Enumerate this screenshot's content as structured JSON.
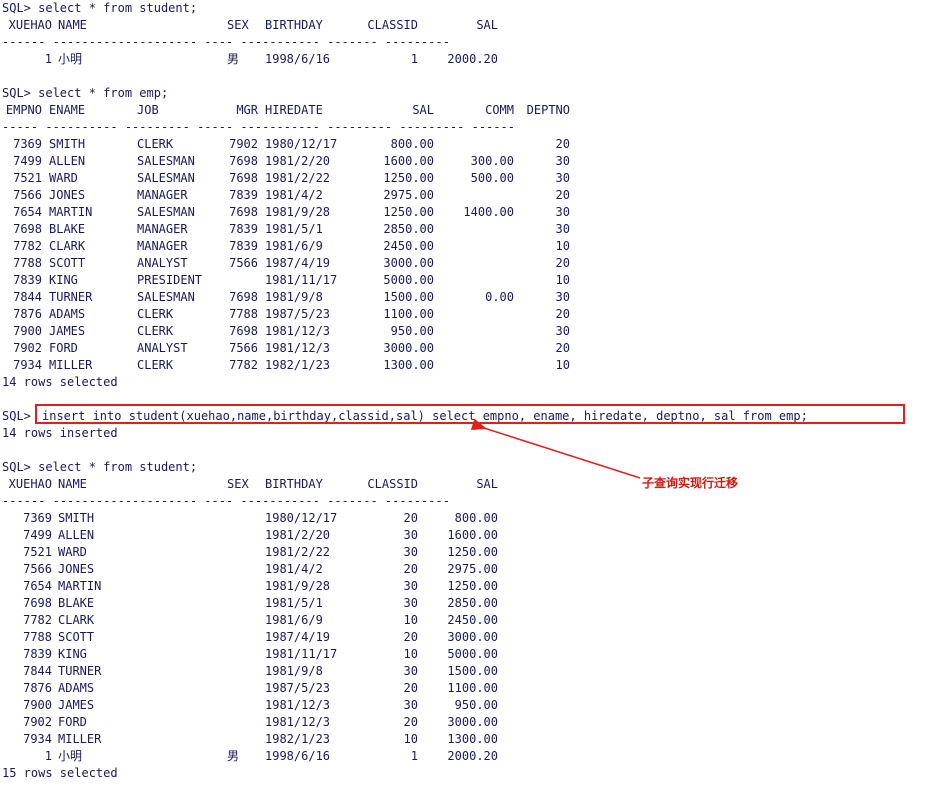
{
  "q1": {
    "prompt": "SQL> select * from student;",
    "headers": [
      "XUEHAO",
      "NAME",
      "SEX",
      "BIRTHDAY",
      "CLASSID",
      "SAL"
    ],
    "rule": "------ -------------------- ---- ----------- ------- ---------",
    "rows": [
      [
        "1",
        "小明",
        "男",
        "1998/6/16",
        "1",
        "2000.20"
      ]
    ]
  },
  "q2": {
    "prompt": "SQL> select * from emp;",
    "headers": [
      "EMPNO",
      "ENAME",
      "JOB",
      "MGR",
      "HIREDATE",
      "SAL",
      "COMM",
      "DEPTNO"
    ],
    "rule": "----- ---------- --------- ----- ----------- --------- --------- ------",
    "rows": [
      [
        "7369",
        "SMITH",
        "CLERK",
        "7902",
        "1980/12/17",
        "800.00",
        "",
        "20"
      ],
      [
        "7499",
        "ALLEN",
        "SALESMAN",
        "7698",
        "1981/2/20",
        "1600.00",
        "300.00",
        "30"
      ],
      [
        "7521",
        "WARD",
        "SALESMAN",
        "7698",
        "1981/2/22",
        "1250.00",
        "500.00",
        "30"
      ],
      [
        "7566",
        "JONES",
        "MANAGER",
        "7839",
        "1981/4/2",
        "2975.00",
        "",
        "20"
      ],
      [
        "7654",
        "MARTIN",
        "SALESMAN",
        "7698",
        "1981/9/28",
        "1250.00",
        "1400.00",
        "30"
      ],
      [
        "7698",
        "BLAKE",
        "MANAGER",
        "7839",
        "1981/5/1",
        "2850.00",
        "",
        "30"
      ],
      [
        "7782",
        "CLARK",
        "MANAGER",
        "7839",
        "1981/6/9",
        "2450.00",
        "",
        "10"
      ],
      [
        "7788",
        "SCOTT",
        "ANALYST",
        "7566",
        "1987/4/19",
        "3000.00",
        "",
        "20"
      ],
      [
        "7839",
        "KING",
        "PRESIDENT",
        "",
        "1981/11/17",
        "5000.00",
        "",
        "10"
      ],
      [
        "7844",
        "TURNER",
        "SALESMAN",
        "7698",
        "1981/9/8",
        "1500.00",
        "0.00",
        "30"
      ],
      [
        "7876",
        "ADAMS",
        "CLERK",
        "7788",
        "1987/5/23",
        "1100.00",
        "",
        "20"
      ],
      [
        "7900",
        "JAMES",
        "CLERK",
        "7698",
        "1981/12/3",
        "950.00",
        "",
        "30"
      ],
      [
        "7902",
        "FORD",
        "ANALYST",
        "7566",
        "1981/12/3",
        "3000.00",
        "",
        "20"
      ],
      [
        "7934",
        "MILLER",
        "CLERK",
        "7782",
        "1982/1/23",
        "1300.00",
        "",
        "10"
      ]
    ],
    "footer": "14 rows selected"
  },
  "insert": {
    "prompt": "SQL>",
    "command": "insert into student(xuehao,name,birthday,classid,sal) select empno, ename, hiredate, deptno, sal from emp;",
    "footer": "14 rows inserted",
    "annotation": "子查询实现行迁移",
    "box_color": "#e0201a"
  },
  "q3": {
    "prompt": "SQL> select * from student;",
    "headers": [
      "XUEHAO",
      "NAME",
      "SEX",
      "BIRTHDAY",
      "CLASSID",
      "SAL"
    ],
    "rule": "------ -------------------- ---- ----------- ------- ---------",
    "rows": [
      [
        "7369",
        "SMITH",
        "",
        "1980/12/17",
        "20",
        "800.00"
      ],
      [
        "7499",
        "ALLEN",
        "",
        "1981/2/20",
        "30",
        "1600.00"
      ],
      [
        "7521",
        "WARD",
        "",
        "1981/2/22",
        "30",
        "1250.00"
      ],
      [
        "7566",
        "JONES",
        "",
        "1981/4/2",
        "20",
        "2975.00"
      ],
      [
        "7654",
        "MARTIN",
        "",
        "1981/9/28",
        "30",
        "1250.00"
      ],
      [
        "7698",
        "BLAKE",
        "",
        "1981/5/1",
        "30",
        "2850.00"
      ],
      [
        "7782",
        "CLARK",
        "",
        "1981/6/9",
        "10",
        "2450.00"
      ],
      [
        "7788",
        "SCOTT",
        "",
        "1987/4/19",
        "20",
        "3000.00"
      ],
      [
        "7839",
        "KING",
        "",
        "1981/11/17",
        "10",
        "5000.00"
      ],
      [
        "7844",
        "TURNER",
        "",
        "1981/9/8",
        "30",
        "1500.00"
      ],
      [
        "7876",
        "ADAMS",
        "",
        "1987/5/23",
        "20",
        "1100.00"
      ],
      [
        "7900",
        "JAMES",
        "",
        "1981/12/3",
        "30",
        "950.00"
      ],
      [
        "7902",
        "FORD",
        "",
        "1981/12/3",
        "20",
        "3000.00"
      ],
      [
        "7934",
        "MILLER",
        "",
        "1982/1/23",
        "10",
        "1300.00"
      ],
      [
        "1",
        "小明",
        "男",
        "1998/6/16",
        "1",
        "2000.20"
      ]
    ],
    "footer": "15 rows selected"
  }
}
